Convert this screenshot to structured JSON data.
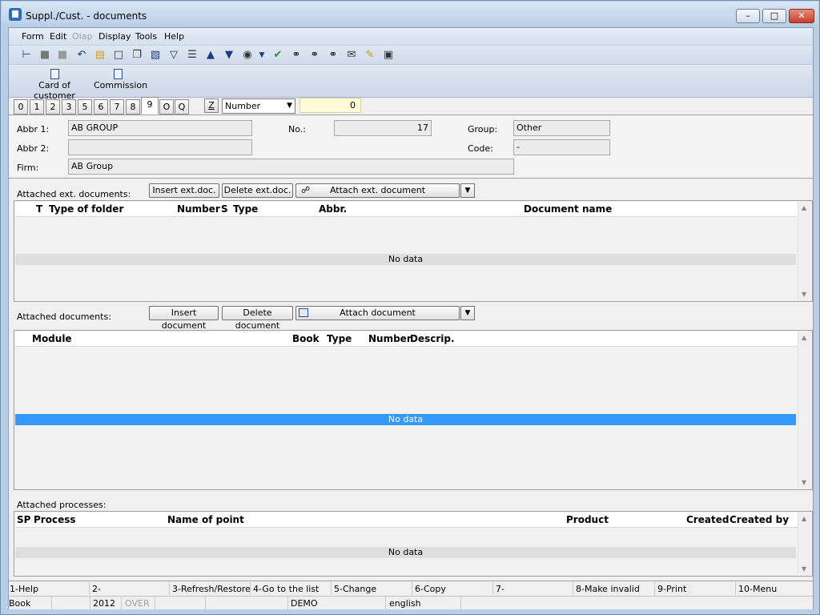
{
  "window": {
    "title": "Suppl./Cust. - documents"
  },
  "menu": [
    "Form",
    "Edit",
    "Olap",
    "Display",
    "Tools",
    "Help"
  ],
  "toolbar_icons": [
    "tree-icon",
    "save-icon",
    "save-disabled-icon",
    "undo-icon",
    "open-folder-icon",
    "new-document-icon",
    "copy-icon",
    "book-icon",
    "filter-icon",
    "filter-list-icon",
    "arrow-up-icon",
    "arrow-down-icon",
    "camera-icon",
    "dropdown-icon",
    "check-icon",
    "binoculars-icon",
    "binoculars-next-icon",
    "binoculars-prev-icon",
    "mail-icon",
    "notes-icon",
    "window-icon"
  ],
  "actions": {
    "card": "Card of customer",
    "commission": "Commission"
  },
  "tabs": [
    "0",
    "1",
    "2",
    "3",
    "5",
    "6",
    "7",
    "8",
    "9",
    "O",
    "Q"
  ],
  "sort": {
    "z": "Z",
    "field": "Number",
    "search_value": "0"
  },
  "header": {
    "abbr1_label": "Abbr 1:",
    "abbr1": "AB GROUP",
    "abbr2_label": "Abbr 2:",
    "abbr2": "",
    "firm_label": "Firm:",
    "firm": "AB Group",
    "no_label": "No.:",
    "no": "17",
    "group_label": "Group:",
    "group": "Other",
    "code_label": "Code:",
    "code": "-"
  },
  "ext_docs": {
    "label": "Attached ext. documents:",
    "insert": "Insert ext.doc.",
    "delete": "Delete ext.doc.",
    "attach": "Attach ext. document",
    "columns": [
      "T",
      "Type of folder",
      "Number",
      "S",
      "Type",
      "Abbr.",
      "Document name"
    ],
    "no_data": "No data"
  },
  "docs": {
    "label": "Attached documents:",
    "insert": "Insert document",
    "delete": "Delete document",
    "attach": "Attach document",
    "columns": [
      "Module",
      "Book",
      "Type",
      "Number",
      "Descrip."
    ],
    "no_data": "No data"
  },
  "processes": {
    "label": "Attached processes:",
    "columns": [
      "SP",
      "Process",
      "Name of point",
      "Product",
      "Created",
      "Created by"
    ],
    "no_data": "No data"
  },
  "fkeys": [
    "1-Help",
    "2-",
    "3-Refresh/Restore",
    "4-Go to the list",
    "5-Change",
    "6-Copy",
    "7-",
    "8-Make invalid",
    "9-Print",
    "10-Menu"
  ],
  "status": {
    "book": "Book",
    "year": "2012",
    "over": "OVER",
    "db": "DEMO",
    "lang": "english"
  }
}
